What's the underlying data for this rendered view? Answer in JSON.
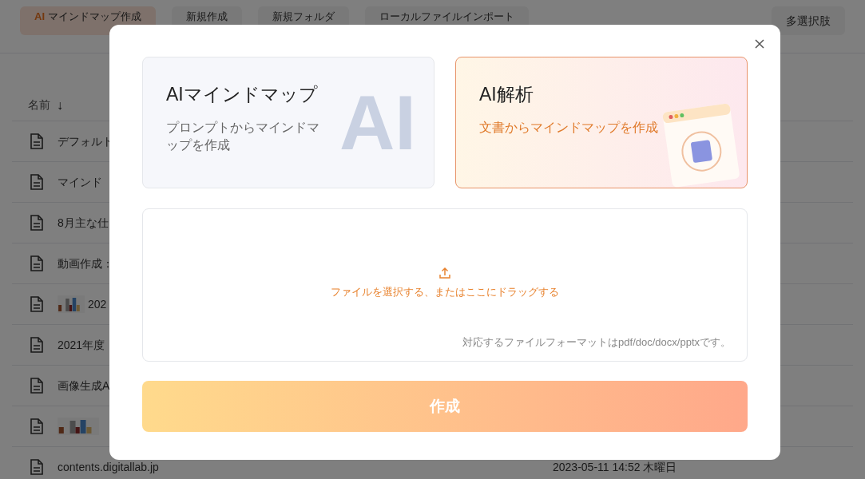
{
  "toolbar": {
    "buttons": [
      {
        "badge": "AI",
        "label": "マインドマップ作成",
        "selected": true
      },
      {
        "label": "新規作成",
        "selected": false
      },
      {
        "label": "新規フォルダ",
        "selected": false
      },
      {
        "label": "ローカルファイルインポート",
        "selected": false
      }
    ],
    "right_button": "多選択肢"
  },
  "file_list": {
    "header": {
      "label": "名前",
      "sort_arrow": "↓"
    },
    "rows": [
      {
        "name": "デフォルト"
      },
      {
        "name": "マインド"
      },
      {
        "name": "8月主な仕"
      },
      {
        "name": "動画作成："
      },
      {
        "name": "202",
        "kind": "picture_name"
      },
      {
        "name": "2021年度"
      },
      {
        "name": "画像生成A"
      },
      {
        "kind": "picture"
      },
      {
        "name": "contents.digitallab.jp",
        "date": "2023-05-11 14:52 木曜日"
      }
    ]
  },
  "dialog": {
    "cards": [
      {
        "title": "AIマインドマップ",
        "description": "プロンプトからマインドマップを作成",
        "backdrop_text": "AI",
        "selected": false
      },
      {
        "title": "AI解析",
        "description": "文書からマインドマップを作成",
        "selected": true
      }
    ],
    "upload": {
      "prompt": "ファイルを選択する、またはここにドラッグする",
      "note": "対応するファイルフォーマットはpdf/doc/docx/pptxです。"
    },
    "submit": "作成"
  }
}
